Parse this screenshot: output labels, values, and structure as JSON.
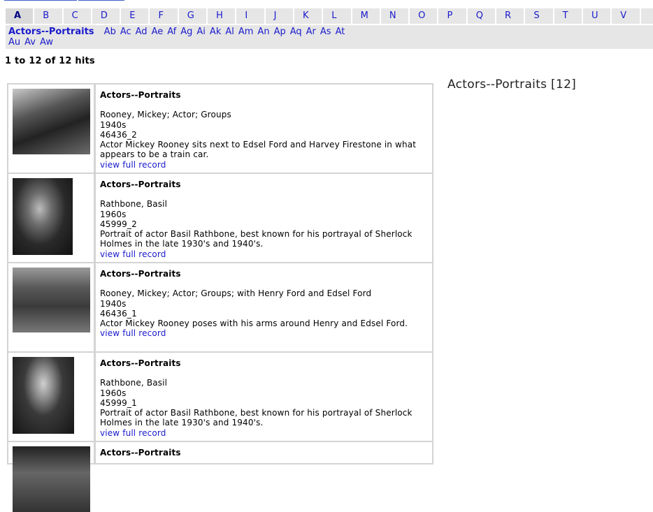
{
  "alphabet": [
    "A",
    "B",
    "C",
    "D",
    "E",
    "F",
    "G",
    "H",
    "I",
    "J",
    "K",
    "L",
    "M",
    "N",
    "O",
    "P",
    "Q",
    "R",
    "S",
    "T",
    "U",
    "V"
  ],
  "active_letter": "A",
  "subterms": {
    "current": "Actors--Portraits",
    "row1": [
      "Ab",
      "Ac",
      "Ad",
      "Ae",
      "Af",
      "Ag",
      "Ai",
      "Ak",
      "Al",
      "Am",
      "An",
      "Ap",
      "Aq",
      "Ar",
      "As",
      "At"
    ],
    "row2": [
      "Au",
      "Av",
      "Aw"
    ]
  },
  "hits_text": "1 to 12  of  12 hits",
  "side_heading": "Actors--Portraits [12]",
  "records": [
    {
      "title": "Actors--Portraits",
      "lines": [
        "Rooney, Mickey; Actor; Groups",
        "1940s",
        "46436_2",
        "Actor Mickey Rooney sits next to Edsel Ford and Harvey Firestone in what appears to be a train car."
      ],
      "link": "view full record"
    },
    {
      "title": "Actors--Portraits",
      "lines": [
        "Rathbone, Basil",
        "1960s",
        "45999_2",
        "Portrait of actor Basil Rathbone, best known for his portrayal of Sherlock Holmes in the late 1930's and 1940's."
      ],
      "link": "view full record"
    },
    {
      "title": "Actors--Portraits",
      "lines": [
        "Rooney, Mickey; Actor; Groups; with Henry Ford and Edsel Ford",
        "1940s",
        "46436_1",
        "Actor Mickey Rooney poses with his arms around Henry and Edsel Ford."
      ],
      "link": "view full record"
    },
    {
      "title": "Actors--Portraits",
      "lines": [
        "Rathbone, Basil",
        "1960s",
        "45999_1",
        "Portrait of actor Basil Rathbone, best known for his portrayal of Sherlock Holmes in the late 1930's and 1940's."
      ],
      "link": "view full record"
    },
    {
      "title": "Actors--Portraits",
      "lines": [],
      "link": ""
    }
  ]
}
